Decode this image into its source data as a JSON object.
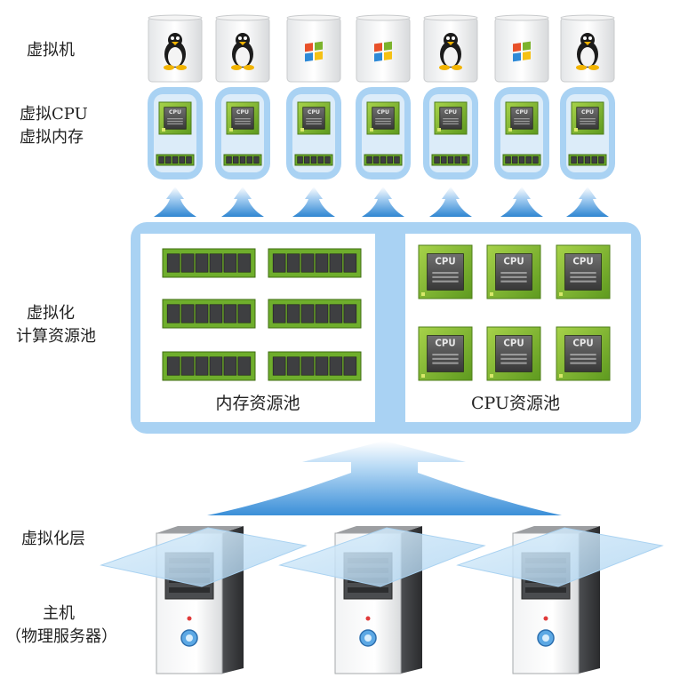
{
  "left_labels": {
    "vm": "虚拟机",
    "vcpu": "虚拟CPU",
    "vmem": "虚拟内存",
    "virt": "虚拟化",
    "pool": "计算资源池",
    "layer": "虚拟化层",
    "host": "主机",
    "host_sub": "（物理服务器）"
  },
  "pools": {
    "memory_label": "内存资源池",
    "cpu_label": "CPU资源池"
  },
  "chip_label": "CPU",
  "vms": [
    {
      "os": "linux-penguin-icon"
    },
    {
      "os": "linux-penguin-icon"
    },
    {
      "os": "windows-logo-icon"
    },
    {
      "os": "windows-logo-icon"
    },
    {
      "os": "linux-penguin-icon"
    },
    {
      "os": "windows-logo-icon"
    },
    {
      "os": "linux-penguin-icon"
    }
  ],
  "servers": [
    {
      "icon": "server-tower-icon"
    },
    {
      "icon": "server-tower-icon"
    },
    {
      "icon": "server-tower-icon"
    }
  ],
  "colors": {
    "pool_border": "#a9d2f3",
    "arrow": "#4a96d8",
    "chip_green": "#7db62f",
    "ram_green": "#5f9d2a",
    "plane": "#bfe0f6"
  }
}
